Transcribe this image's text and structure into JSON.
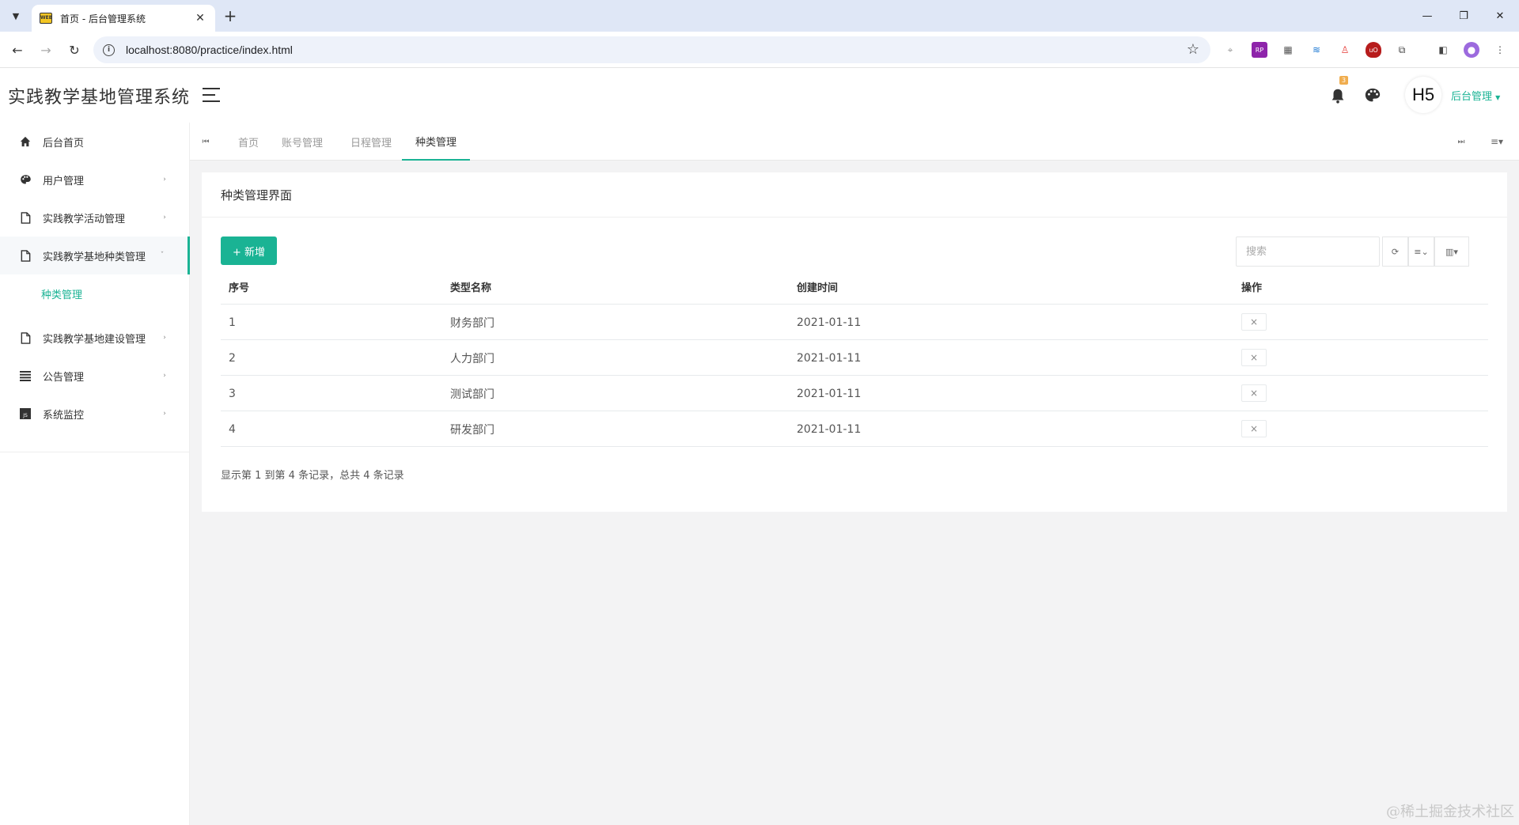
{
  "browser": {
    "tab_title": "首页 - 后台管理系统",
    "url": "localhost:8080/practice/index.html"
  },
  "header": {
    "app_title": "实践教学基地管理系统",
    "notification_count": "3",
    "avatar_text": "H5",
    "user_menu_label": "后台管理"
  },
  "sidebar": {
    "items": [
      {
        "label": "后台首页",
        "icon": "home-icon"
      },
      {
        "label": "用户管理",
        "icon": "palette-icon"
      },
      {
        "label": "实践教学活动管理",
        "icon": "file-icon"
      },
      {
        "label": "实践教学基地种类管理",
        "icon": "file-icon"
      },
      {
        "label": "实践教学基地建设管理",
        "icon": "file-icon"
      },
      {
        "label": "公告管理",
        "icon": "list-icon"
      },
      {
        "label": "系统监控",
        "icon": "js-icon"
      }
    ],
    "sub_item": "种类管理"
  },
  "tabs": [
    "首页",
    "账号管理",
    "日程管理",
    "种类管理"
  ],
  "panel": {
    "title": "种类管理界面",
    "add_button": "+ 新增",
    "search_placeholder": "搜索"
  },
  "table": {
    "columns": [
      "序号",
      "类型名称",
      "创建时间",
      "操作"
    ],
    "rows": [
      {
        "id": "1",
        "name": "财务部门",
        "created": "2021-01-11"
      },
      {
        "id": "2",
        "name": "人力部门",
        "created": "2021-01-11"
      },
      {
        "id": "3",
        "name": "测试部门",
        "created": "2021-01-11"
      },
      {
        "id": "4",
        "name": "研发部门",
        "created": "2021-01-11"
      }
    ],
    "delete_symbol": "×",
    "pagination_info": "显示第 1 到第 4 条记录，总共 4 条记录"
  },
  "watermark": "@稀土掘金技术社区",
  "colors": {
    "accent": "#1ab394",
    "badge": "#f0ad4e"
  }
}
